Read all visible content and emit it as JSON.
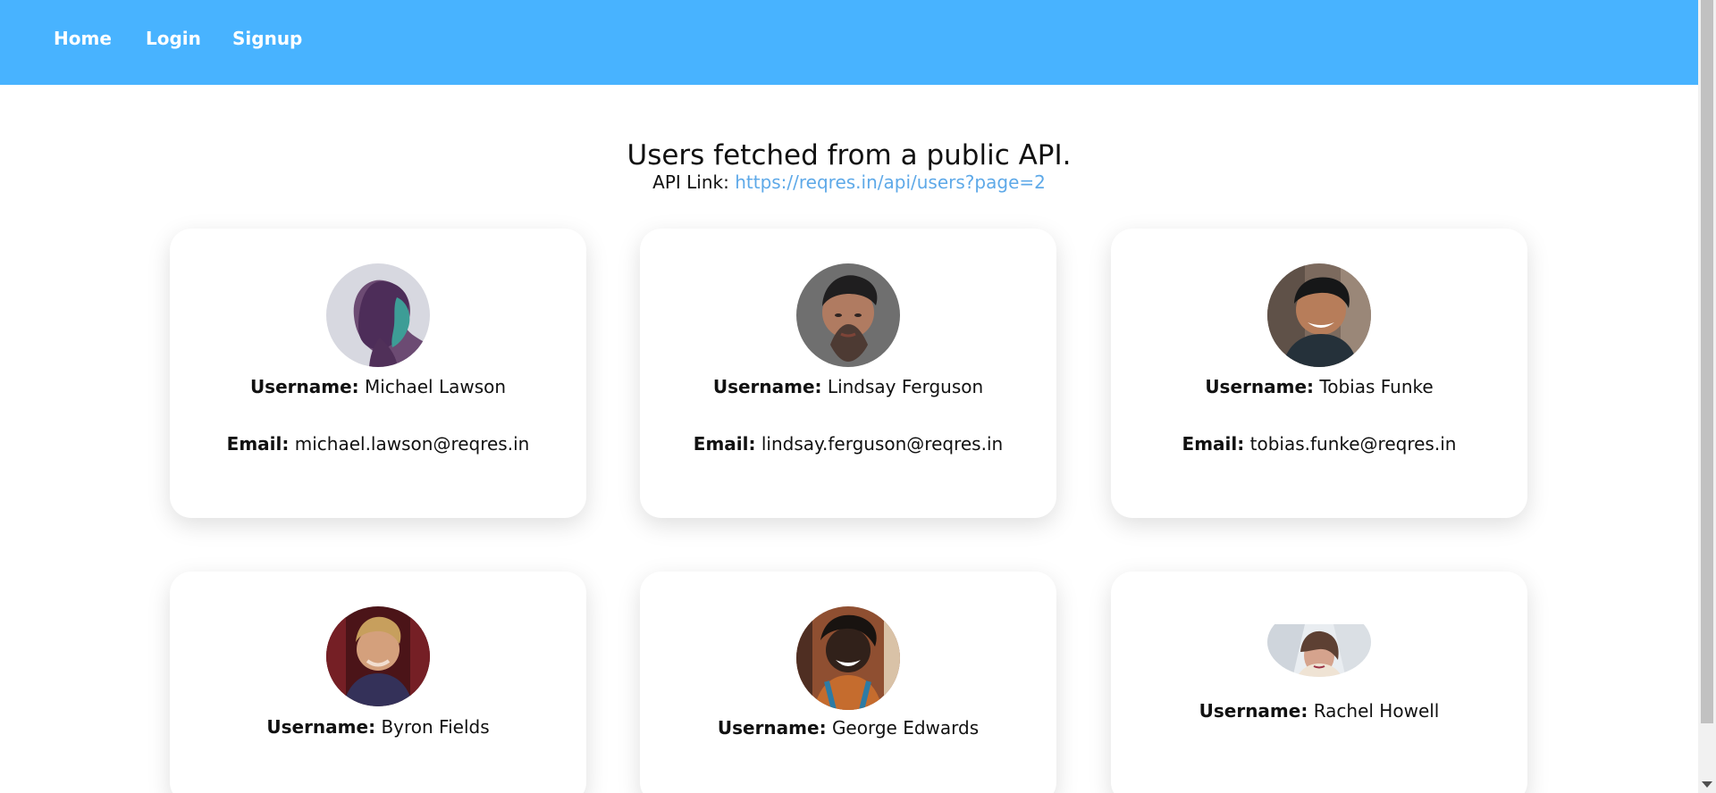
{
  "nav": {
    "items": [
      {
        "label": "Home"
      },
      {
        "label": "Login"
      },
      {
        "label": "Signup"
      }
    ],
    "background": "#48b3ff"
  },
  "main": {
    "title": "Users fetched from a public API.",
    "api_label": "API Link:",
    "api_url": "https://reqres.in/api/users?page=2"
  },
  "labels": {
    "username": "Username:",
    "email": "Email:"
  },
  "users": [
    {
      "name": "Michael Lawson",
      "email": "michael.lawson@reqres.in",
      "avatar": "woman-profile-avatar"
    },
    {
      "name": "Lindsay Ferguson",
      "email": "lindsay.ferguson@reqres.in",
      "avatar": "young-man-avatar"
    },
    {
      "name": "Tobias Funke",
      "email": "tobias.funke@reqres.in",
      "avatar": "smiling-man-avatar"
    },
    {
      "name": "Byron Fields",
      "email": "",
      "avatar": "blond-man-avatar"
    },
    {
      "name": "George Edwards",
      "email": "",
      "avatar": "smiling-man-dreadlocks-avatar"
    },
    {
      "name": "Rachel Howell",
      "email": "",
      "avatar": "woman-snow-avatar"
    }
  ],
  "colors": {
    "link": "#5ea9e8",
    "text": "#111111"
  }
}
